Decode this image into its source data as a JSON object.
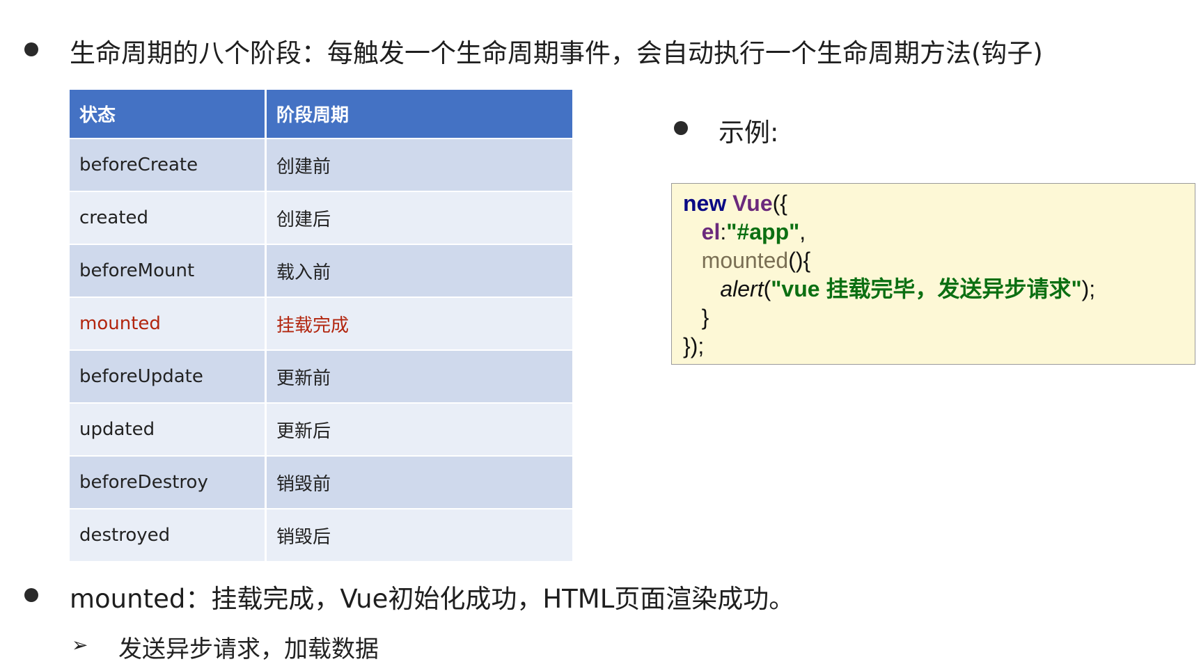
{
  "heading1": "生命周期的八个阶段：每触发一个生命周期事件，会自动执行一个生命周期方法(钩子)",
  "table": {
    "headers": [
      "状态",
      "阶段周期"
    ],
    "rows": [
      {
        "state": "beforeCreate",
        "phase": "创建前"
      },
      {
        "state": "created",
        "phase": "创建后"
      },
      {
        "state": "beforeMount",
        "phase": "载入前"
      },
      {
        "state": "mounted",
        "phase": "挂载完成"
      },
      {
        "state": "beforeUpdate",
        "phase": "更新前"
      },
      {
        "state": "updated",
        "phase": "更新后"
      },
      {
        "state": "beforeDestroy",
        "phase": "销毁前"
      },
      {
        "state": "destroyed",
        "phase": "销毁后"
      }
    ],
    "highlight_color": "#b2250e",
    "header_color": "#4472c4"
  },
  "example_label": "示例:",
  "code": {
    "kw_new": "new",
    "cls_vue": "Vue",
    "open1": "({",
    "prop_el": "el",
    "colon": ":",
    "str_app": "\"#app\"",
    "comma": ",",
    "meth_mounted": "mounted",
    "meth_rest": "(){",
    "fn_alert": "alert",
    "paren_open": "(",
    "str_msg": "\"vue 挂载完毕，发送异步请求\"",
    "paren_close": ");",
    "close_brace": "}",
    "close_all": "});"
  },
  "heading2": "mounted：挂载完成，Vue初始化成功，HTML页面渲染成功。",
  "sub_item": "发送异步请求，加载数据",
  "sub_arrow": "➢"
}
